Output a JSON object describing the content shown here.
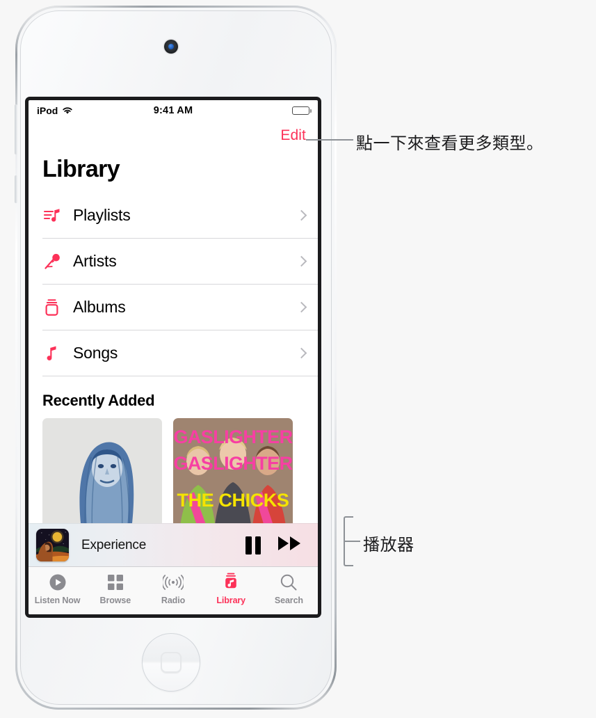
{
  "device": {
    "name": "iPod touch"
  },
  "status_bar": {
    "carrier": "iPod",
    "wifi_icon": "wifi-icon",
    "time": "9:41 AM",
    "battery_icon": "battery-full-icon"
  },
  "nav": {
    "edit_label": "Edit"
  },
  "page": {
    "title": "Library"
  },
  "library_rows": [
    {
      "icon": "playlist-note-icon",
      "label": "Playlists",
      "chevron": "chevron-right-icon"
    },
    {
      "icon": "microphone-icon",
      "label": "Artists",
      "chevron": "chevron-right-icon"
    },
    {
      "icon": "albums-stack-icon",
      "label": "Albums",
      "chevron": "chevron-right-icon"
    },
    {
      "icon": "music-note-icon",
      "label": "Songs",
      "chevron": "chevron-right-icon"
    }
  ],
  "recently_added": {
    "title": "Recently Added",
    "albums": [
      {
        "name": "album-artwork-blue-portrait",
        "alt": "Blue-toned portrait of a woman with long hair on a light gray background"
      },
      {
        "name": "album-artwork-gaslighter",
        "title_lines": [
          "GASLIGHTER",
          "GASLIGHTER"
        ],
        "artist": "THE CHICKS"
      }
    ]
  },
  "now_playing": {
    "artwork": "album-artwork-night-moon",
    "track_title": "Experience",
    "pause_label": "pause-icon",
    "forward_label": "fast-forward-icon"
  },
  "tab_bar": {
    "tabs": [
      {
        "icon": "play-circle-icon",
        "label": "Listen Now",
        "active": false
      },
      {
        "icon": "grid-squares-icon",
        "label": "Browse",
        "active": false
      },
      {
        "icon": "radio-waves-icon",
        "label": "Radio",
        "active": false
      },
      {
        "icon": "library-box-icon",
        "label": "Library",
        "active": true
      },
      {
        "icon": "magnifier-icon",
        "label": "Search",
        "active": false
      }
    ]
  },
  "callouts": [
    {
      "text": "點一下來查看更多類型。",
      "target": "edit-button"
    },
    {
      "text": "播放器",
      "target": "now-playing-bar"
    }
  ],
  "colors": {
    "accent_red": "#fc3158",
    "tab_inactive": "#8b8b90",
    "separator": "#d7d7da",
    "callout_line": "#8d9196"
  }
}
